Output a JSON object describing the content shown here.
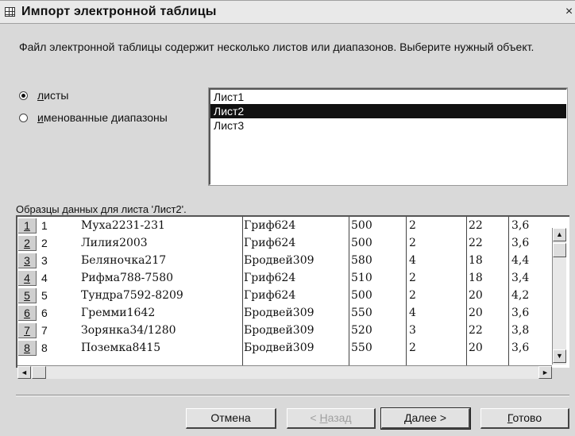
{
  "window": {
    "title": "Импорт электронной таблицы",
    "close_symbol": "×"
  },
  "description": "Файл электронной таблицы содержит несколько листов или диапазонов. Выберите нужный объект.",
  "options": [
    {
      "accel": "л",
      "rest": "исты",
      "checked": true
    },
    {
      "accel": "и",
      "rest": "менованные диапазоны",
      "checked": false
    }
  ],
  "sheets": [
    "Лист1",
    "Лист2",
    "Лист3"
  ],
  "selected_sheet": "Лист2",
  "sample_label": "Образцы данных для листа 'Лист2'.",
  "rows": [
    [
      "1",
      "Муха2231-231",
      "Гриф624",
      "500",
      "2",
      "22",
      "3,6"
    ],
    [
      "2",
      "Лилия2003",
      "Гриф624",
      "500",
      "2",
      "22",
      "3,6"
    ],
    [
      "3",
      "Беляночка217",
      "Бродвей309",
      "580",
      "4",
      "18",
      "4,4"
    ],
    [
      "4",
      "Рифма788-7580",
      "Гриф624",
      "510",
      "2",
      "18",
      "3,4"
    ],
    [
      "5",
      "Тундра7592-8209",
      "Гриф624",
      "500",
      "2",
      "20",
      "4,2"
    ],
    [
      "6",
      "Гремми1642",
      "Бродвей309",
      "550",
      "4",
      "20",
      "3,6"
    ],
    [
      "7",
      "Зорянка34/1280",
      "Бродвей309",
      "520",
      "3",
      "22",
      "3,8"
    ],
    [
      "8",
      "Поземка8415",
      "Бродвей309",
      "550",
      "2",
      "20",
      "3,6"
    ]
  ],
  "buttons": {
    "cancel": {
      "label": "Отмена"
    },
    "back": {
      "accel": "Н",
      "rest": "азад",
      "prefix": "< "
    },
    "next": {
      "accel": "Д",
      "rest": "алее",
      "suffix": " >"
    },
    "finish": {
      "accel": "Г",
      "rest": "отово"
    }
  },
  "scroll": {
    "up": "▲",
    "down": "▼",
    "left": "◄",
    "right": "►"
  }
}
